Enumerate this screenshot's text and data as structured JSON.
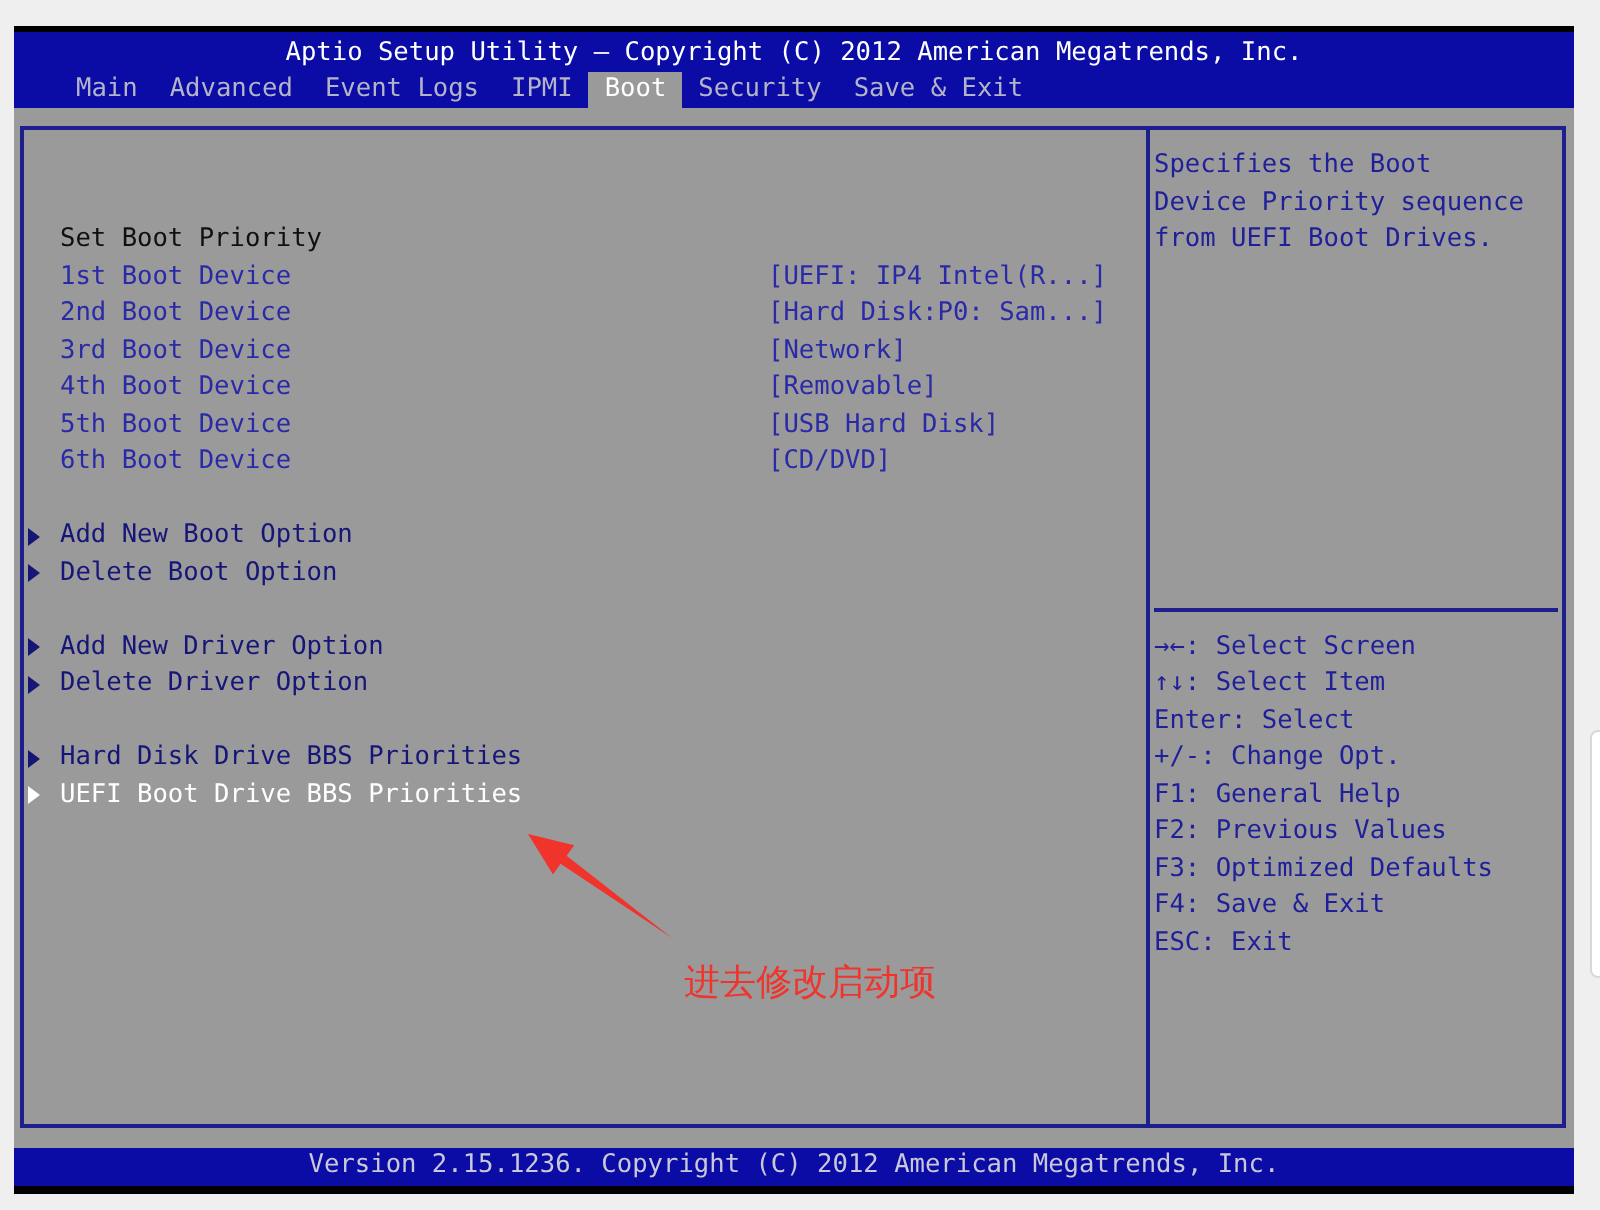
{
  "header": {
    "title": "Aptio Setup Utility – Copyright (C) 2012 American Megatrends, Inc."
  },
  "tabs": [
    {
      "label": "Main",
      "selected": false
    },
    {
      "label": "Advanced",
      "selected": false
    },
    {
      "label": "Event Logs",
      "selected": false
    },
    {
      "label": "IPMI",
      "selected": false
    },
    {
      "label": "Boot",
      "selected": true
    },
    {
      "label": "Security",
      "selected": false
    },
    {
      "label": "Save & Exit",
      "selected": false
    }
  ],
  "main_panel": {
    "section_title": "Set Boot Priority",
    "boot_devices": [
      {
        "label": "1st Boot Device",
        "value": "[UEFI: IP4 Intel(R...]"
      },
      {
        "label": "2nd Boot Device",
        "value": "[Hard Disk:P0: Sam...]"
      },
      {
        "label": "3rd Boot Device",
        "value": "[Network]"
      },
      {
        "label": "4th Boot Device",
        "value": "[Removable]"
      },
      {
        "label": "5th Boot Device",
        "value": "[USB Hard Disk]"
      },
      {
        "label": "6th Boot Device",
        "value": "[CD/DVD]"
      }
    ],
    "submenu_groups": [
      {
        "items": [
          {
            "label": "Add New Boot Option",
            "selected": false
          },
          {
            "label": "Delete Boot Option",
            "selected": false
          }
        ]
      },
      {
        "items": [
          {
            "label": "Add New Driver Option",
            "selected": false
          },
          {
            "label": "Delete Driver Option",
            "selected": false
          }
        ]
      },
      {
        "items": [
          {
            "label": "Hard Disk Drive BBS Priorities",
            "selected": false
          },
          {
            "label": "UEFI Boot Drive BBS Priorities",
            "selected": true
          }
        ]
      }
    ]
  },
  "help_panel": {
    "description": "Specifies the Boot Device Priority sequence from UEFI Boot Drives.",
    "key_legend": [
      "→←: Select Screen",
      "↑↓: Select Item",
      "Enter: Select",
      "+/-: Change Opt.",
      "F1: General Help",
      "F2: Previous Values",
      "F3: Optimized Defaults",
      "F4: Save & Exit",
      "ESC: Exit"
    ]
  },
  "footer": {
    "text": "Version 2.15.1236. Copyright (C) 2012 American Megatrends, Inc."
  },
  "annotation": {
    "text": "进去修改启动项"
  }
}
